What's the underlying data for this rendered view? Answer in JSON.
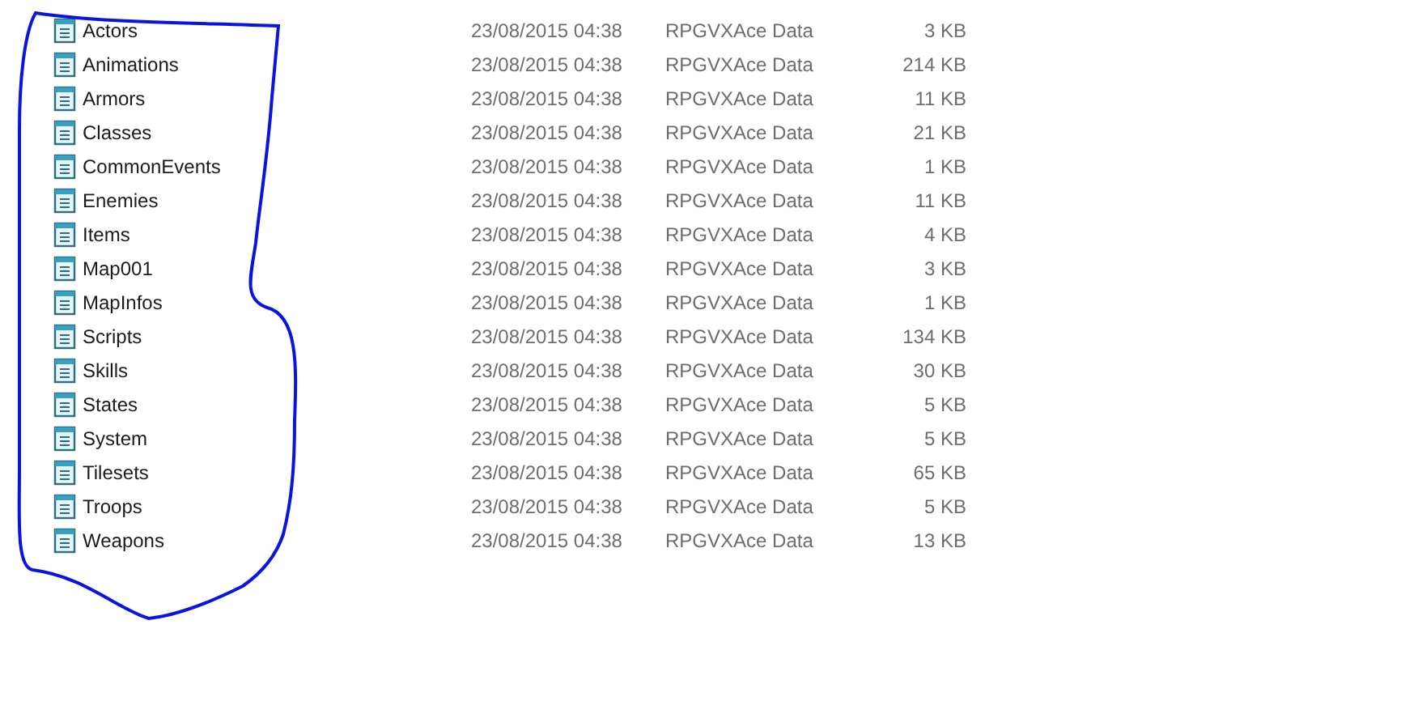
{
  "files": [
    {
      "name": "Actors",
      "modified": "23/08/2015 04:38",
      "type": "RPGVXAce Data",
      "size": "3 KB"
    },
    {
      "name": "Animations",
      "modified": "23/08/2015 04:38",
      "type": "RPGVXAce Data",
      "size": "214 KB"
    },
    {
      "name": "Armors",
      "modified": "23/08/2015 04:38",
      "type": "RPGVXAce Data",
      "size": "11 KB"
    },
    {
      "name": "Classes",
      "modified": "23/08/2015 04:38",
      "type": "RPGVXAce Data",
      "size": "21 KB"
    },
    {
      "name": "CommonEvents",
      "modified": "23/08/2015 04:38",
      "type": "RPGVXAce Data",
      "size": "1 KB"
    },
    {
      "name": "Enemies",
      "modified": "23/08/2015 04:38",
      "type": "RPGVXAce Data",
      "size": "11 KB"
    },
    {
      "name": "Items",
      "modified": "23/08/2015 04:38",
      "type": "RPGVXAce Data",
      "size": "4 KB"
    },
    {
      "name": "Map001",
      "modified": "23/08/2015 04:38",
      "type": "RPGVXAce Data",
      "size": "3 KB"
    },
    {
      "name": "MapInfos",
      "modified": "23/08/2015 04:38",
      "type": "RPGVXAce Data",
      "size": "1 KB"
    },
    {
      "name": "Scripts",
      "modified": "23/08/2015 04:38",
      "type": "RPGVXAce Data",
      "size": "134 KB"
    },
    {
      "name": "Skills",
      "modified": "23/08/2015 04:38",
      "type": "RPGVXAce Data",
      "size": "30 KB"
    },
    {
      "name": "States",
      "modified": "23/08/2015 04:38",
      "type": "RPGVXAce Data",
      "size": "5 KB"
    },
    {
      "name": "System",
      "modified": "23/08/2015 04:38",
      "type": "RPGVXAce Data",
      "size": "5 KB"
    },
    {
      "name": "Tilesets",
      "modified": "23/08/2015 04:38",
      "type": "RPGVXAce Data",
      "size": "65 KB"
    },
    {
      "name": "Troops",
      "modified": "23/08/2015 04:38",
      "type": "RPGVXAce Data",
      "size": "5 KB"
    },
    {
      "name": "Weapons",
      "modified": "23/08/2015 04:38",
      "type": "RPGVXAce Data",
      "size": "13 KB"
    }
  ]
}
